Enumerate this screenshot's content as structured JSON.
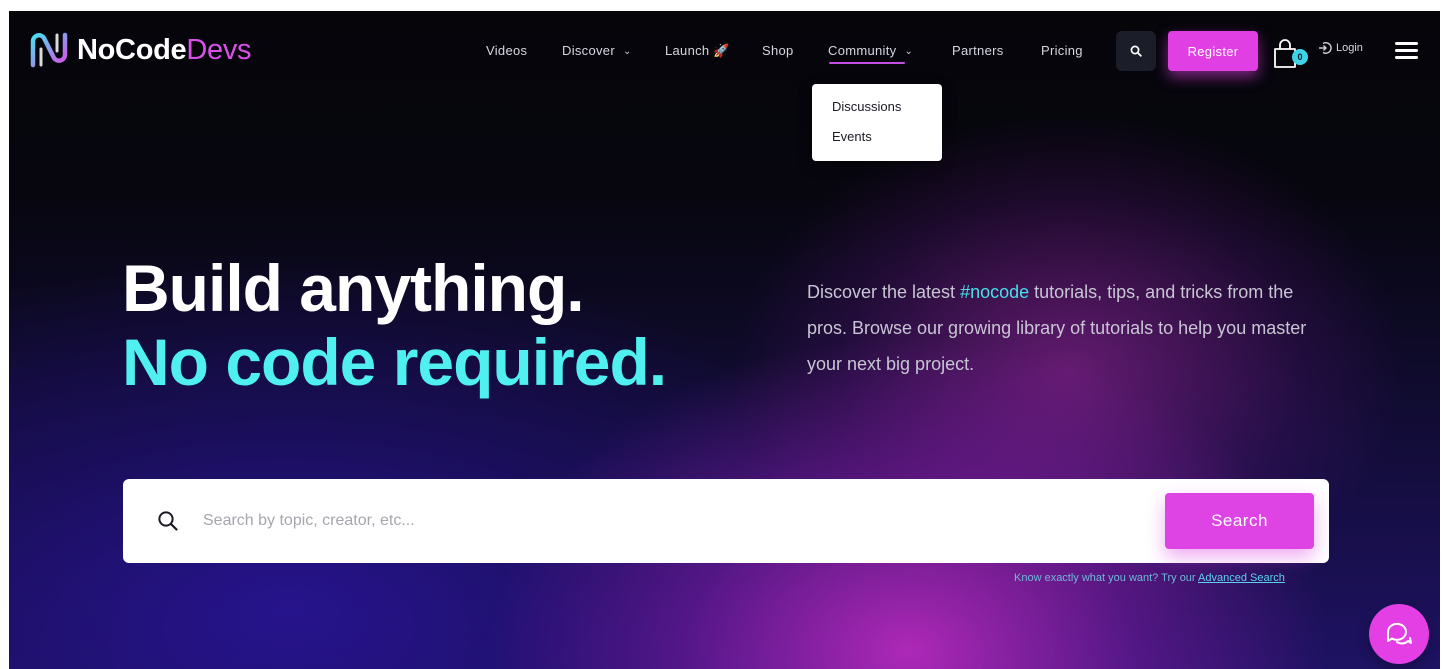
{
  "brand": {
    "name_main": "NoCode",
    "name_accent": "Devs",
    "accent_color": "#d94fe8",
    "cyan_color": "#4ff0ef"
  },
  "nav": {
    "items": [
      {
        "label": "Videos",
        "has_dropdown": false
      },
      {
        "label": "Discover",
        "has_dropdown": true
      },
      {
        "label": "Launch 🚀",
        "has_dropdown": false
      },
      {
        "label": "Shop",
        "has_dropdown": false
      },
      {
        "label": "Community",
        "has_dropdown": true,
        "active": true
      },
      {
        "label": "Partners",
        "has_dropdown": false
      },
      {
        "label": "Pricing",
        "has_dropdown": false
      }
    ],
    "search_icon": "search-icon",
    "register_label": "Register",
    "cart_count": "0",
    "login_label": "Login",
    "menu_icon": "hamburger-icon"
  },
  "community_dropdown": {
    "items": [
      "Discussions",
      "Events"
    ]
  },
  "hero": {
    "headline_line1": "Build anything.",
    "headline_line2": "No code required.",
    "desc_before": "Discover the latest ",
    "desc_tag": "#nocode",
    "desc_after": " tutorials, tips, and tricks from the pros. Browse our growing library of tutorials to help you master your next big project."
  },
  "search": {
    "placeholder": "Search by topic, creator, etc...",
    "value": "",
    "button_label": "Search",
    "hint_text": "Know exactly what you want? Try our ",
    "hint_link": "Advanced Search"
  },
  "chat": {
    "icon": "chat-bubbles-icon"
  }
}
